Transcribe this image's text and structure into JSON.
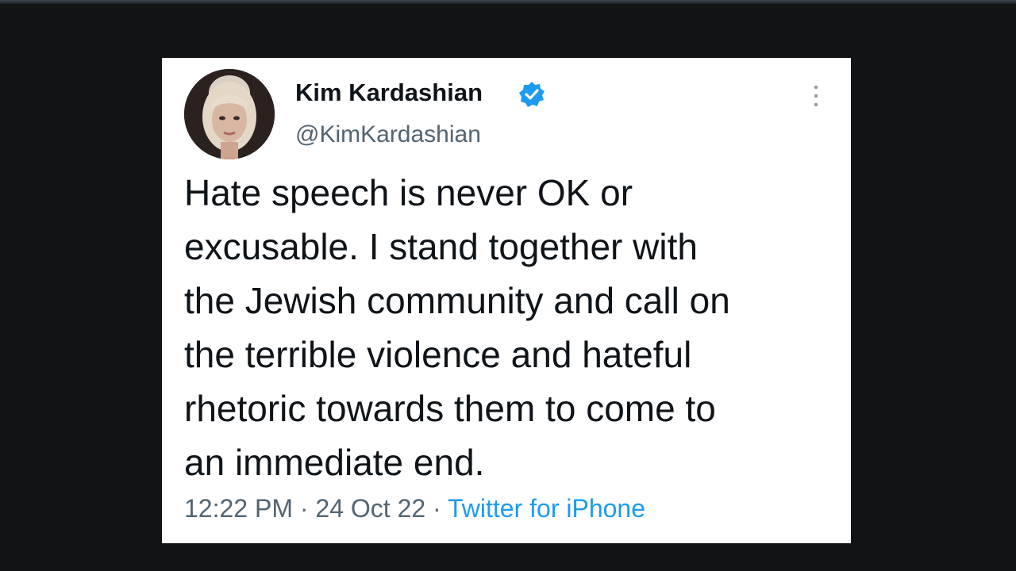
{
  "tweet": {
    "author": {
      "display_name": "Kim Kardashian",
      "handle": "@KimKardashian",
      "verified": true,
      "avatar_icon": "profile-photo",
      "verified_icon": "verified-badge-icon"
    },
    "text": "Hate speech is never OK or\nexcusable. I stand together with\nthe Jewish community and call on\nthe terrible violence and hateful\nrhetoric towards them to come to\nan immediate end.",
    "time": "12:22 PM",
    "separator": "·",
    "date": "24 Oct 22",
    "source": "Twitter for iPhone",
    "more_icon": "more-options-icon"
  },
  "colors": {
    "background": "#121314",
    "card": "#ffffff",
    "text_primary": "#0f1419",
    "text_secondary": "#536471",
    "accent": "#1d9bf0"
  }
}
